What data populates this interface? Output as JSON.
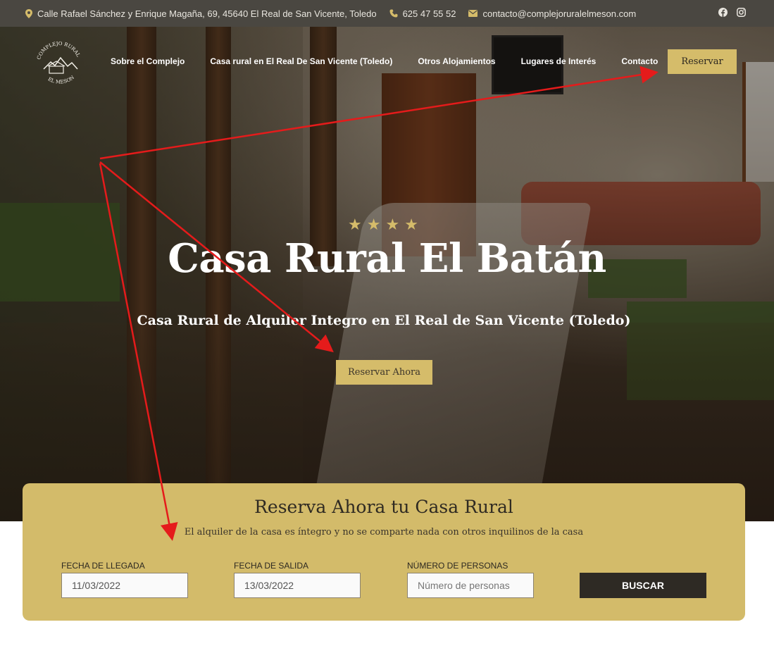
{
  "topbar": {
    "address": "Calle Rafael Sánchez y Enrique Magaña, 69, 45640 El Real de San Vicente, Toledo",
    "phone": "625 47 55 52",
    "email": "contacto@complejoruralelmeson.com",
    "icons": [
      "location-pin-icon",
      "phone-icon",
      "envelope-icon",
      "facebook-icon",
      "instagram-icon"
    ]
  },
  "logo": {
    "top_text": "COMPLEJO RURAL",
    "bottom_text": "EL MESON"
  },
  "nav": {
    "items": [
      "Sobre el Complejo",
      "Casa rural en El Real De San Vicente (Toledo)",
      "Otros Alojamientos",
      "Lugares de Interés",
      "Contacto"
    ],
    "cta": "Reservar"
  },
  "hero": {
    "star_count": 4,
    "title": "Casa Rural El Batán",
    "subtitle": "Casa Rural de Alquiler Integro en El Real de San Vicente (Toledo)",
    "button": "Reservar Ahora"
  },
  "booking": {
    "title": "Reserva Ahora tu Casa Rural",
    "subtitle": "El alquiler de la casa es íntegro y no se comparte nada con otros inquilinos de la casa",
    "arrival_label": "FECHA DE LLEGADA",
    "arrival_value": "11/03/2022",
    "departure_label": "FECHA DE SALIDA",
    "departure_value": "13/03/2022",
    "people_label": "NÚMERO DE PERSONAS",
    "people_placeholder": "Número de personas",
    "search_button": "BUSCAR"
  },
  "colors": {
    "accent_gold": "#d5bc6a",
    "topbar_bg": "#4a4741",
    "dark_button": "#2e2a24",
    "annotation_arrow": "#e51b1b"
  }
}
